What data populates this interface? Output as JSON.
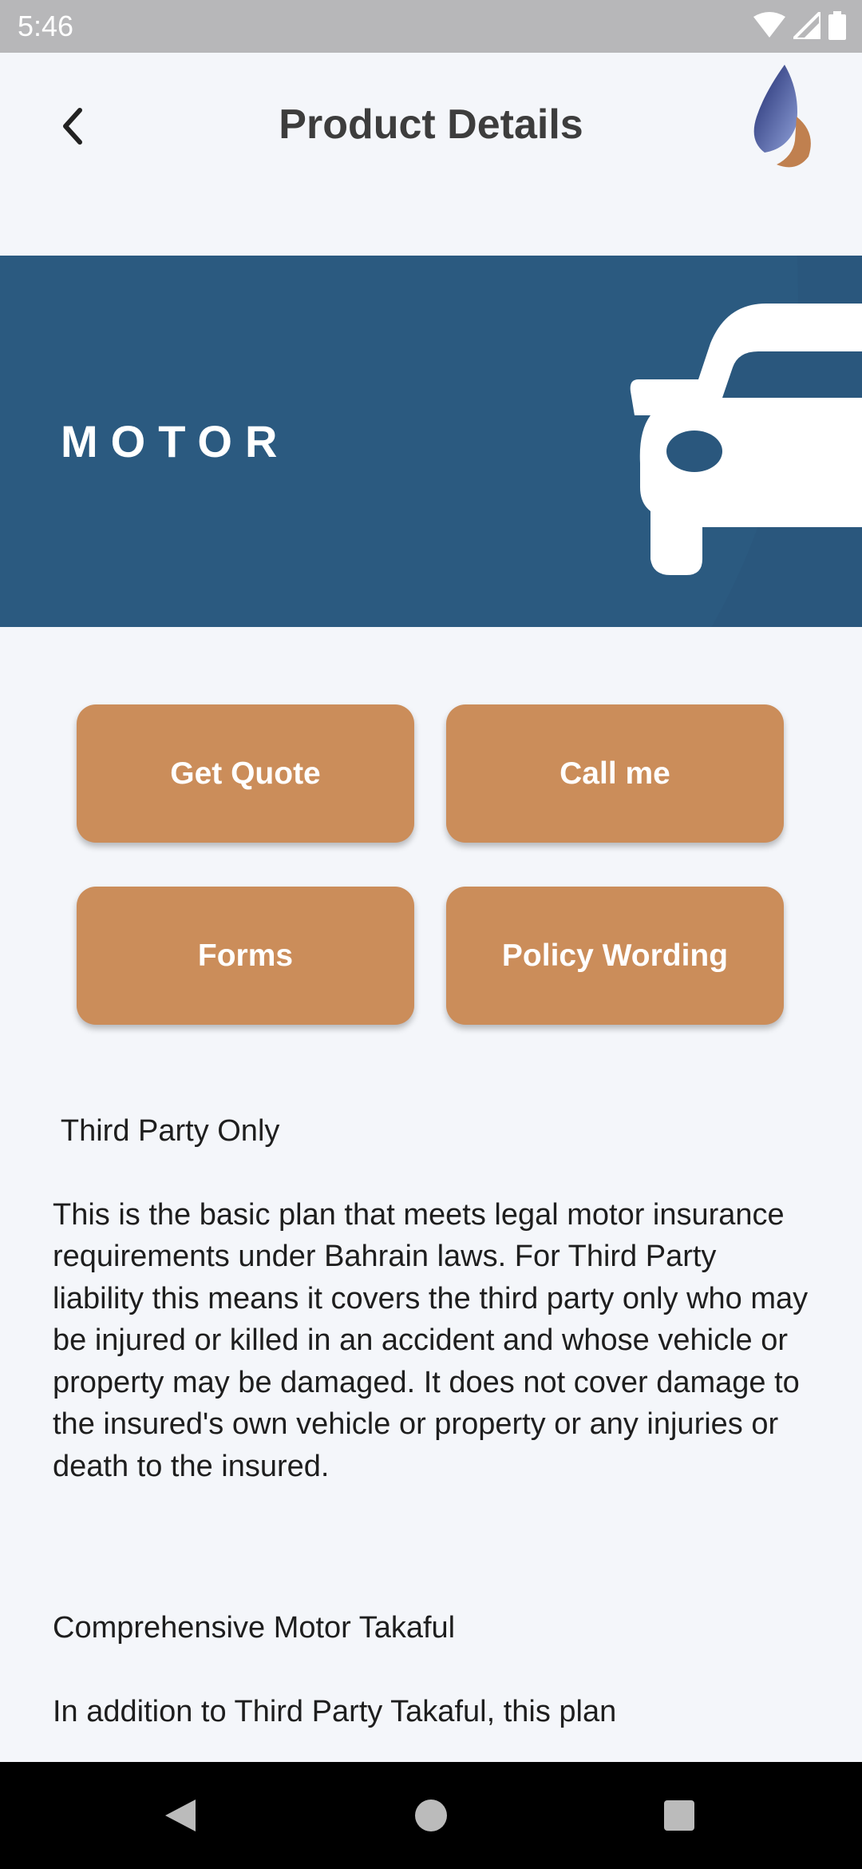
{
  "status_bar": {
    "time": "5:46",
    "icons": [
      "wifi-icon",
      "signal-icon",
      "battery-icon"
    ]
  },
  "header": {
    "title": "Product Details",
    "back_icon": "chevron-left-icon",
    "logo": "company-logo"
  },
  "banner": {
    "label": "MOTOR",
    "icon": "car-icon",
    "background": "#2a577d"
  },
  "actions": {
    "get_quote": "Get Quote",
    "call_me": "Call me",
    "forms": "Forms",
    "policy_wording": "Policy Wording",
    "color": "#cb8d5a"
  },
  "content": {
    "section1_title": " Third Party Only",
    "section1_body": "This is the basic plan that meets legal motor insurance requirements under Bahrain laws. For Third Party liability this means it covers the third party only who may be injured or killed in an accident and whose vehicle or property may be damaged. It does not cover damage to the insured's own vehicle or property or any injuries or death to the insured.",
    "section2_title": "Comprehensive Motor Takaful",
    "section2_body": "In addition to Third Party Takaful, this plan"
  }
}
